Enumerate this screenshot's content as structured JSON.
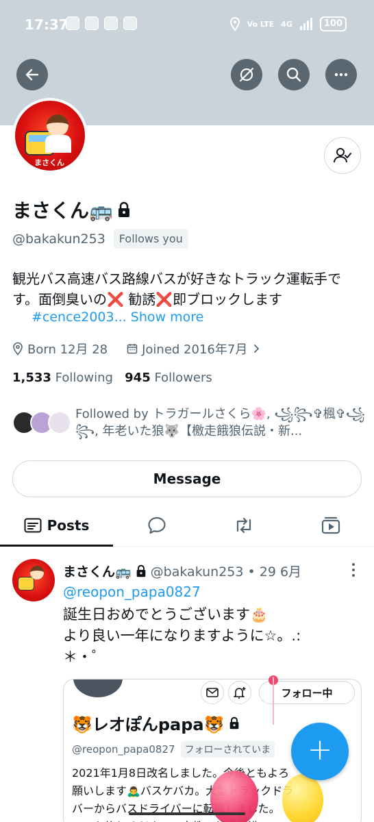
{
  "status_bar": {
    "time": "17:37",
    "network_label": "Vo LTE",
    "signal_label": "4G",
    "battery": "100"
  },
  "profile": {
    "display_name": "まさくん🚌",
    "avatar_name": "まさくん",
    "handle": "@bakakun253",
    "follows_you": "Follows you",
    "bio_line1": "観光バス高速バス路線バスが好きなトラック運転手で",
    "bio_line2": "す。面倒臭いの❌ 勧誘❌即ブロックします",
    "bio_hashtag": "#cence2003...",
    "bio_show_more": "Show more",
    "born": "Born 12月 28",
    "joined": "Joined 2016年7月",
    "following_count": "1,533",
    "following_label": "Following",
    "followers_count": "945",
    "followers_label": "Followers",
    "followed_by_text": "Followed by トラガールさくら🌸, ꧁꧂✞楓✞꧁꧂, 年老いた狼🐺【檄走餓狼伝説・新..."
  },
  "buttons": {
    "message": "Message"
  },
  "tabs": {
    "posts": "Posts"
  },
  "post": {
    "name": "まさくん🚌",
    "meta": "@bakakun253 • 29 6月",
    "mention": "@reopon_papa0827",
    "text": "誕生日おめでとうございます🎂\nより良い一年になりますように☆。.:\n＊・゜"
  },
  "embedded": {
    "follow_button": "フォロー中",
    "name": "🐯レオぽんpapa🐯",
    "handle": "@reopon_papa0827",
    "follows_badge": "フォローされていま",
    "bio": "2021年1月8日改名しました。今後ともよろ\n願いします🙇‍♂️バスケバカ。大型トラックドラ\nバーからバスドライバーに転職しました。\nロ。お許しください。宗教、ねずみ講"
  },
  "colors": {
    "accent": "#1d9bf0",
    "banner": "#c9d3d9",
    "muted_text": "#536471"
  }
}
